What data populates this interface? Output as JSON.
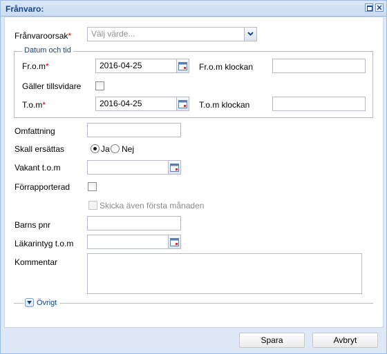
{
  "window": {
    "title": "Frånvaro:"
  },
  "form": {
    "reason": {
      "label": "Frånvaroorsak",
      "required_mark": "*",
      "placeholder": "Välj värde..."
    },
    "datetime_group": {
      "legend": "Datum och tid",
      "from": {
        "label": "Fr.o.m",
        "required_mark": "*",
        "value": "2016-04-25"
      },
      "from_time": {
        "label": "Fr.o.m klockan",
        "value": ""
      },
      "valid_until_further": {
        "label": "Gäller tillsvidare",
        "checked": false
      },
      "to": {
        "label": "T.o.m",
        "required_mark": "*",
        "value": "2016-04-25"
      },
      "to_time": {
        "label": "T.o.m klockan",
        "value": ""
      }
    },
    "extent": {
      "label": "Omfattning",
      "value": ""
    },
    "compensate": {
      "label": "Skall ersättas",
      "options": [
        "Ja",
        "Nej"
      ],
      "selected": "Ja"
    },
    "vacant_until": {
      "label": "Vakant t.o.m",
      "value": ""
    },
    "pre_reported": {
      "label": "Förrapporterad",
      "checked": false
    },
    "send_first_month": {
      "label": "Skicka även första månaden",
      "checked": false,
      "disabled": true
    },
    "child_pnr": {
      "label": "Barns pnr",
      "value": ""
    },
    "medical_cert_until": {
      "label": "Läkarintyg t.o.m",
      "value": ""
    },
    "comment": {
      "label": "Kommentar",
      "value": ""
    },
    "other_section": {
      "label": "Övrigt",
      "collapsed": true
    }
  },
  "buttons": {
    "save": "Spara",
    "cancel": "Avbryt"
  }
}
